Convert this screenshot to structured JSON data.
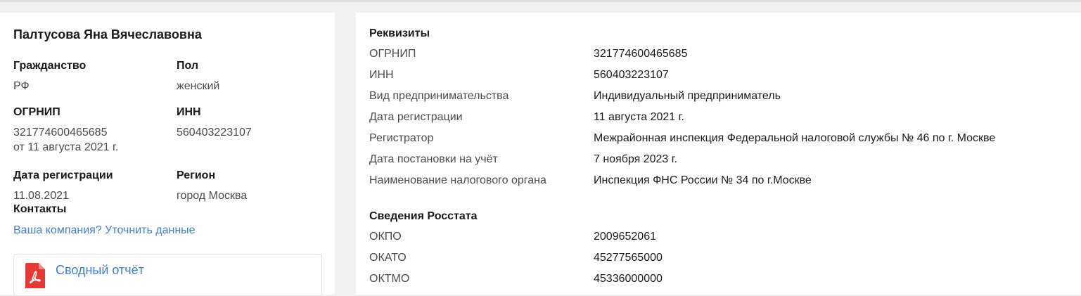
{
  "person": {
    "name": "Палтусова Яна Вячеславовна",
    "fields": [
      {
        "label": "Гражданство",
        "value": "РФ",
        "value2": ""
      },
      {
        "label": "Пол",
        "value": "женский",
        "value2": ""
      },
      {
        "label": "ОГРНИП",
        "value": "321774600465685",
        "value2": "от 11 августа 2021 г."
      },
      {
        "label": "ИНН",
        "value": "560403223107",
        "value2": ""
      },
      {
        "label": "Дата регистрации",
        "value": "11.08.2021",
        "value2": ""
      },
      {
        "label": "Регион",
        "value": "город Москва",
        "value2": ""
      }
    ],
    "contacts_title": "Контакты",
    "contacts_link": "Ваша компания? Уточнить данные",
    "report_label": "Сводный отчёт"
  },
  "requisites": {
    "title": "Реквизиты",
    "rows": [
      {
        "key": "ОГРНИП",
        "value": "321774600465685"
      },
      {
        "key": "ИНН",
        "value": "560403223107"
      },
      {
        "key": "Вид предпринимательства",
        "value": "Индивидуальный предприниматель"
      },
      {
        "key": "Дата регистрации",
        "value": "11 августа 2021 г."
      },
      {
        "key": "Регистратор",
        "value": "Межрайонная инспекция Федеральной налоговой службы № 46 по г. Москве"
      },
      {
        "key": "Дата постановки на учёт",
        "value": "7 ноября 2023 г."
      },
      {
        "key": "Наименование налогового органа",
        "value": "Инспекция ФНС России № 34 по г.Москве"
      }
    ]
  },
  "rosstat": {
    "title": "Сведения Росстата",
    "rows": [
      {
        "key": "ОКПО",
        "value": "2009652061"
      },
      {
        "key": "ОКАТО",
        "value": "45277565000"
      },
      {
        "key": "ОКТМО",
        "value": "45336000000"
      }
    ]
  },
  "colors": {
    "link": "#3f7fd0",
    "pdf_red": "#e53935",
    "background": "#f1f1f1"
  },
  "icons": {
    "report": "pdf-file-icon"
  }
}
